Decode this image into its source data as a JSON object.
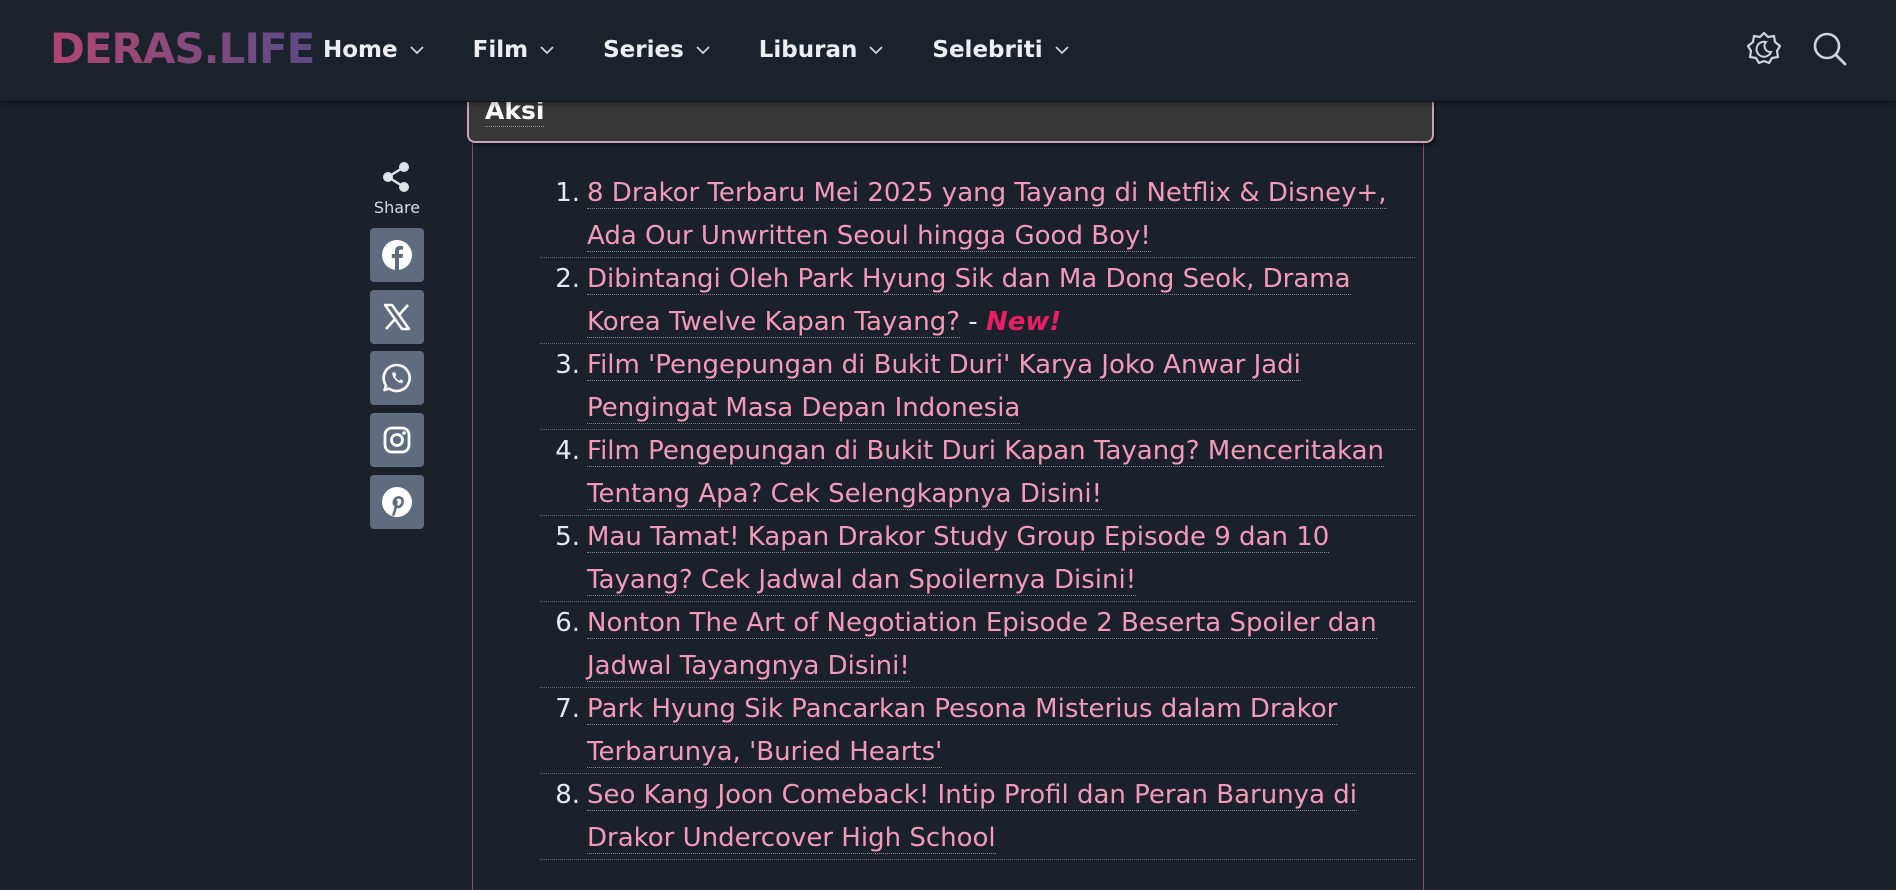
{
  "header": {
    "logo": "DERAS.LIFE",
    "nav": [
      {
        "label": "Home"
      },
      {
        "label": "Film"
      },
      {
        "label": "Series"
      },
      {
        "label": "Liburan"
      },
      {
        "label": "Selebriti"
      }
    ],
    "icons": [
      "theme-toggle-icon",
      "search-icon"
    ]
  },
  "share": {
    "label": "Share",
    "buttons": [
      "facebook",
      "x",
      "whatsapp",
      "instagram",
      "pinterest"
    ]
  },
  "box": {
    "title": "Aksi",
    "items": [
      {
        "num": "1.",
        "title": "8 Drakor Terbaru Mei 2025 yang Tayang di Netflix & Disney+, Ada Our Unwritten Seoul hingga Good Boy!"
      },
      {
        "num": "2.",
        "title": "Dibintangi Oleh Park Hyung Sik dan Ma Dong Seok, Drama Korea Twelve Kapan Tayang?",
        "separator": " - ",
        "badge": "New!"
      },
      {
        "num": "3.",
        "title": "Film 'Pengepungan di Bukit Duri' Karya Joko Anwar Jadi Pengingat Masa Depan Indonesia"
      },
      {
        "num": "4.",
        "title": "Film Pengepungan di Bukit Duri Kapan Tayang? Menceritakan Tentang Apa? Cek Selengkapnya Disini!"
      },
      {
        "num": "5.",
        "title": "Mau Tamat! Kapan Drakor Study Group Episode 9 dan 10 Tayang? Cek Jadwal dan Spoilernya Disini!"
      },
      {
        "num": "6.",
        "title": "Nonton The Art of Negotiation Episode 2 Beserta Spoiler dan Jadwal Tayangnya Disini!"
      },
      {
        "num": "7.",
        "title": "Park Hyung Sik Pancarkan Pesona Misterius dalam Drakor Terbarunya, 'Buried Hearts'"
      },
      {
        "num": "8.",
        "title": "Seo Kang Joon Comeback! Intip Profil dan Peran Barunya di Drakor Undercover High School"
      }
    ]
  },
  "colors": {
    "background": "#1b212b",
    "link": "#f49ab9",
    "new_badge": "#ea1f63",
    "share_button": "#5f6b7f"
  }
}
